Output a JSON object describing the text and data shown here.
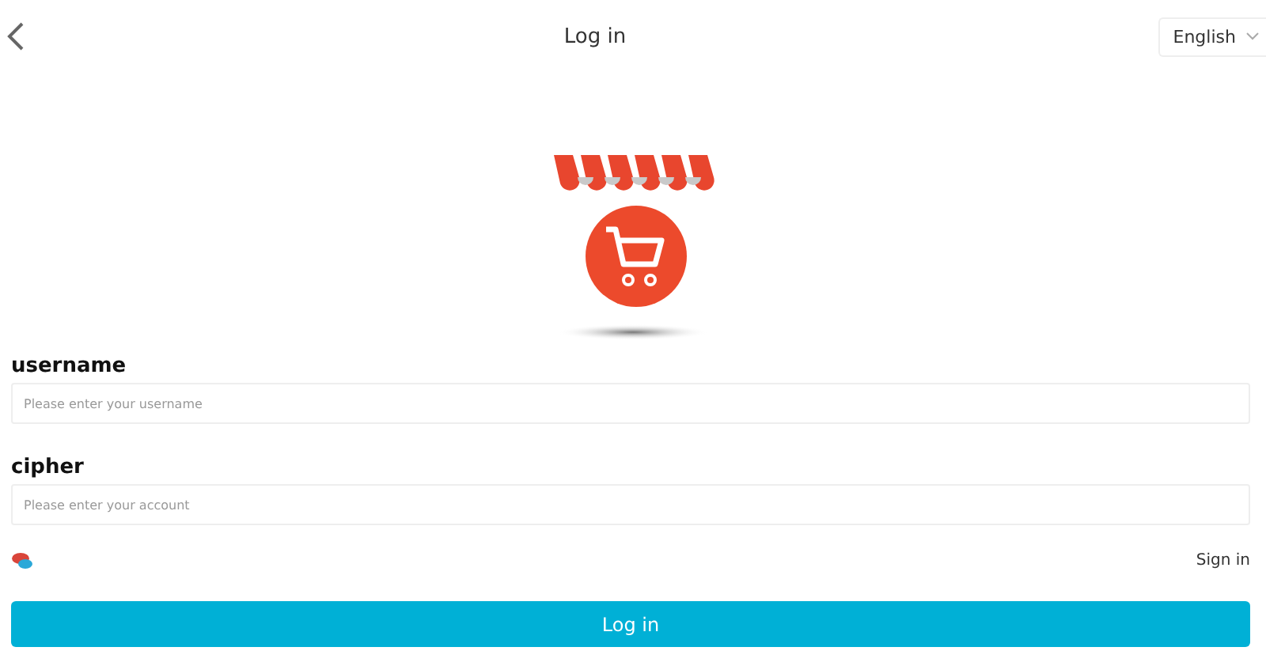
{
  "header": {
    "title": "Log in",
    "language": "English"
  },
  "fields": [
    {
      "label": "username",
      "placeholder": "Please enter your username"
    },
    {
      "label": "cipher",
      "placeholder": "Please enter your account"
    }
  ],
  "sign_in_link": "Sign in",
  "submit_button": "Log in"
}
